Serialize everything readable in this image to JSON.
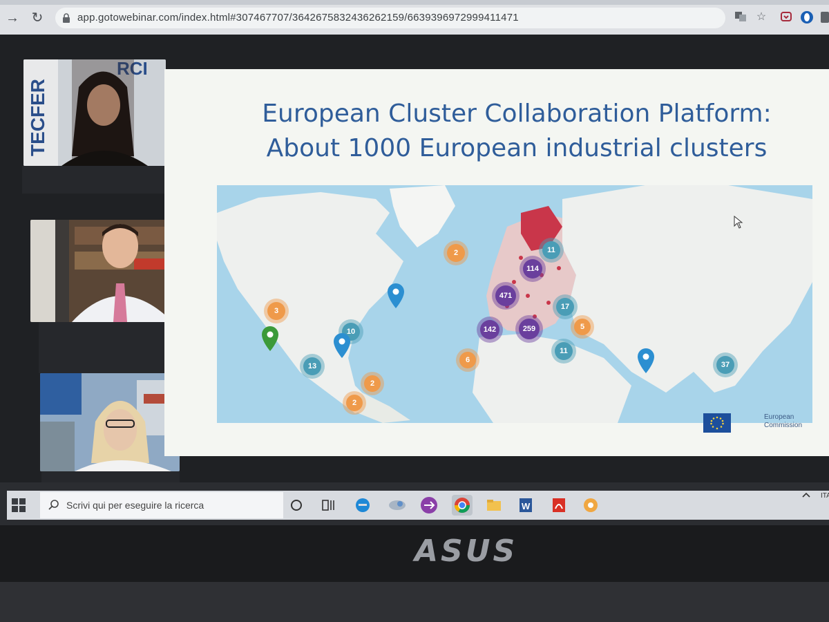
{
  "browser": {
    "url": "app.gotowebinar.com/index.html#307467707/3642675832436262159/6639396972999411471",
    "nav_forward_icon": "→",
    "nav_reload_icon": "↻",
    "star_icon": "☆"
  },
  "slide": {
    "title_line1": "European Cluster Collaboration Platform:",
    "title_line2": "About 1000 European industrial clusters",
    "footer_logo_text_1": "European",
    "footer_logo_text_2": "Commission"
  },
  "map": {
    "clusters": [
      {
        "label": "2",
        "color": "#ef9a4a"
      },
      {
        "label": "11",
        "color": "#4a9db6"
      },
      {
        "label": "114",
        "color": "#6a3f9d"
      },
      {
        "label": "471",
        "color": "#6a3f9d"
      },
      {
        "label": "17",
        "color": "#4a9db6"
      },
      {
        "label": "142",
        "color": "#6a3f9d"
      },
      {
        "label": "259",
        "color": "#6a3f9d"
      },
      {
        "label": "5",
        "color": "#ef9a4a"
      },
      {
        "label": "11",
        "color": "#4a9db6"
      },
      {
        "label": "6",
        "color": "#ef9a4a"
      },
      {
        "label": "3",
        "color": "#ef9a4a"
      },
      {
        "label": "10",
        "color": "#4a9db6"
      },
      {
        "label": "13",
        "color": "#4a9db6"
      },
      {
        "label": "2",
        "color": "#ef9a4a"
      },
      {
        "label": "2",
        "color": "#ef9a4a"
      },
      {
        "label": "37",
        "color": "#4a9db6"
      }
    ],
    "pin_colors": {
      "blue": "#2c8fd1",
      "green": "#3b9a3a"
    }
  },
  "taskbar": {
    "search_placeholder": "Scrivi qui per eseguire la ricerca",
    "tray_lang": "ITA"
  },
  "device": {
    "brand": "ASUS"
  }
}
